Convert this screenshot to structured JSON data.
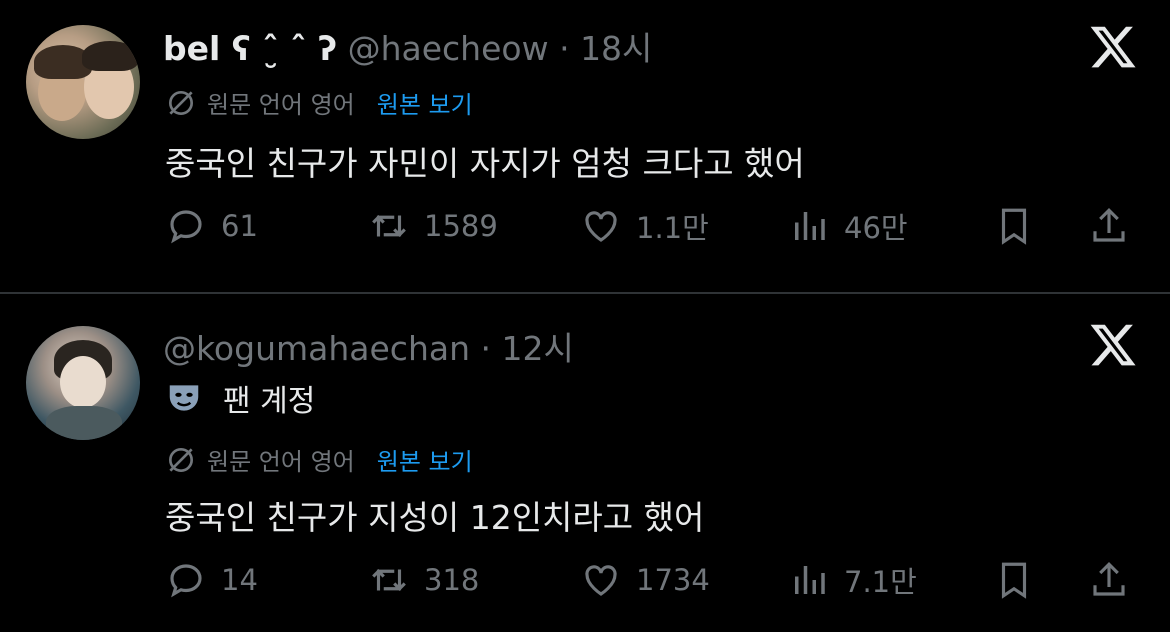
{
  "tweets": [
    {
      "display_name": "bel ʕ ˆ̮ ˆ ʔ",
      "handle": "@haecheow",
      "separator": "·",
      "time": "18시",
      "translated_from": "원문 언어 영어",
      "show_original": "원본 보기",
      "text": "중국인 친구가 자민이 자지가 엄청 크다고 했어",
      "replies": "61",
      "retweets": "1589",
      "likes": "1.1만",
      "views": "46만"
    },
    {
      "handle": "@kogumahaechan",
      "separator": "·",
      "time": "12시",
      "fan_account": "팬 계정",
      "translated_from": "원문 언어 영어",
      "show_original": "원본 보기",
      "text": "중국인 친구가 지성이 12인치라고 했어",
      "replies": "14",
      "retweets": "318",
      "likes": "1734",
      "views": "7.1만"
    }
  ],
  "colors": {
    "background": "#000000",
    "text": "#e7e9ea",
    "muted": "#71767b",
    "link": "#1d9bf0",
    "divider": "#2f3336"
  },
  "icons": [
    "x-logo-icon",
    "translate-globe-icon",
    "reply-icon",
    "retweet-icon",
    "like-icon",
    "views-icon",
    "bookmark-icon",
    "share-icon",
    "mask-icon"
  ]
}
